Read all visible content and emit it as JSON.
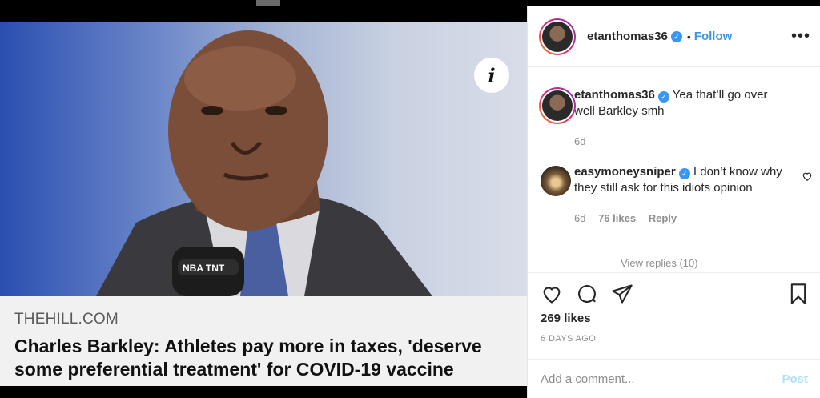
{
  "post": {
    "username": "etanthomas36",
    "follow_label": "Follow",
    "more_label": "•••"
  },
  "media": {
    "source": "THEHILL.COM",
    "headline": "Charles Barkley: Athletes pay more in taxes, 'deserve some preferential treatment' for COVID-19 vaccine",
    "info_glyph": "i",
    "mic_label": "NBA TNT"
  },
  "comments": [
    {
      "username": "etanthomas36",
      "text": "Yea that’ll go over well Barkley smh",
      "age": "6d"
    },
    {
      "username": "easymoneysniper",
      "text": "I don’t know why they still ask for this idiots opinion",
      "age": "6d",
      "likes": "76 likes",
      "reply_label": "Reply"
    }
  ],
  "view_replies": "View replies (10)",
  "likes_count": "269 likes",
  "posted_ago": "6 DAYS AGO",
  "comment_box": {
    "placeholder": "Add a comment...",
    "post_label": "Post"
  },
  "colors": {
    "accent": "#3897f0",
    "post_disabled": "#b2dffc",
    "muted": "#8e8e8e"
  },
  "icons": [
    "info-icon",
    "verified-icon",
    "more-icon",
    "heart-icon",
    "comment-icon",
    "share-icon",
    "bookmark-icon"
  ]
}
